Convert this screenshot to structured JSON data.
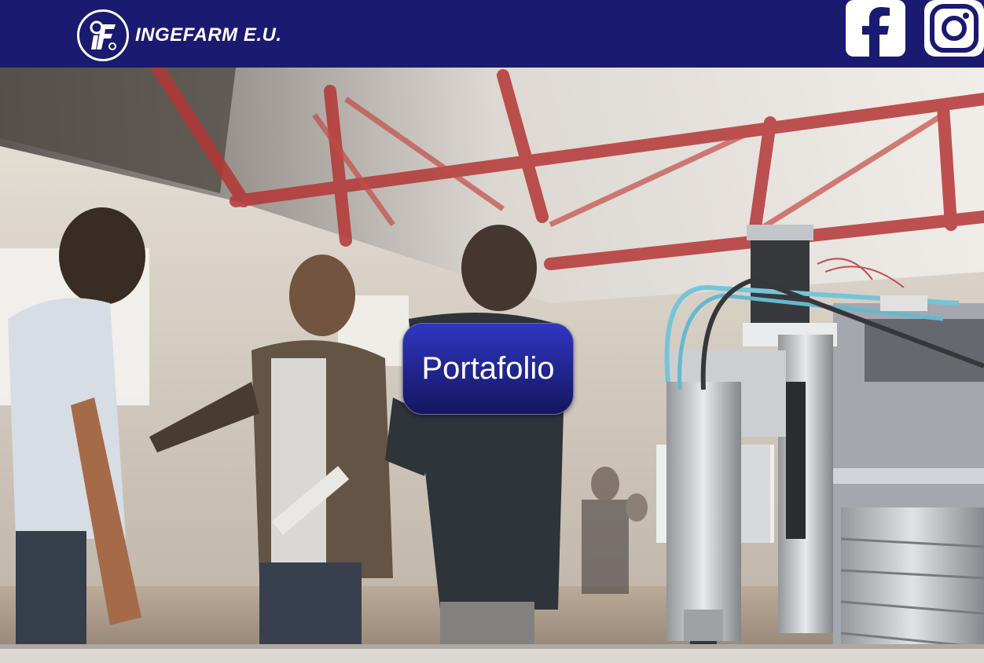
{
  "header": {
    "brand_name": "INGEFARM E.U.",
    "logo_icon": "ingefarm-logo",
    "background": "#1a1a70"
  },
  "social": {
    "items": [
      {
        "icon": "facebook-icon"
      },
      {
        "icon": "instagram-icon"
      }
    ]
  },
  "hero": {
    "cta_label": "Portafolio",
    "cta_color": "#2a2fa8"
  }
}
